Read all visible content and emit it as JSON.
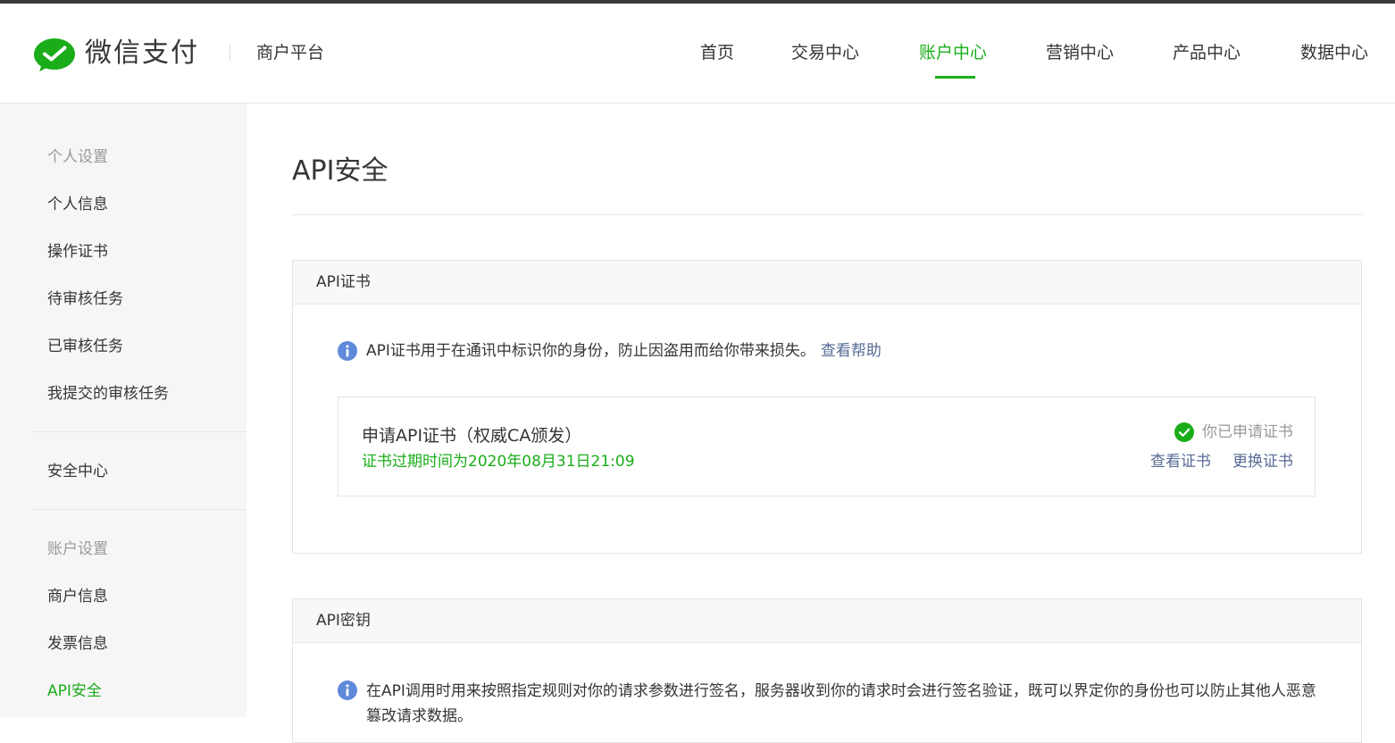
{
  "header": {
    "brand": "微信支付",
    "platform": "商户平台",
    "nav": [
      {
        "label": "首页",
        "active": false
      },
      {
        "label": "交易中心",
        "active": false
      },
      {
        "label": "账户中心",
        "active": true
      },
      {
        "label": "营销中心",
        "active": false
      },
      {
        "label": "产品中心",
        "active": false
      },
      {
        "label": "数据中心",
        "active": false
      }
    ]
  },
  "sidebar": {
    "personal_header": "个人设置",
    "personal_items": [
      "个人信息",
      "操作证书",
      "待审核任务",
      "已审核任务",
      "我提交的审核任务"
    ],
    "security_center": "安全中心",
    "account_header": "账户设置",
    "account_items": [
      "商户信息",
      "发票信息",
      "API安全"
    ],
    "active_item": "API安全"
  },
  "main": {
    "title": "API安全",
    "cert_panel": {
      "title": "API证书",
      "info": "API证书用于在通讯中标识你的身份，防止因盗用而给你带来损失。",
      "help_link": "查看帮助",
      "cert_name": "申请API证书（权威CA颁发）",
      "expiry": "证书过期时间为2020年08月31日21:09",
      "status": "你已申请证书",
      "view_link": "查看证书",
      "replace_link": "更换证书"
    },
    "key_panel": {
      "title": "API密钥",
      "info": "在API调用时用来按照指定规则对你的请求参数进行签名，服务器收到你的请求时会进行签名验证，既可以界定你的身份也可以防止其他人恶意篡改请求数据。"
    }
  },
  "colors": {
    "accent": "#1aad19",
    "link": "#576b95",
    "info_icon": "#5f89d9",
    "sidebar_bg": "#f6f6f6"
  },
  "icons": [
    "wechat-pay-logo",
    "info-icon",
    "check-circle-icon"
  ]
}
